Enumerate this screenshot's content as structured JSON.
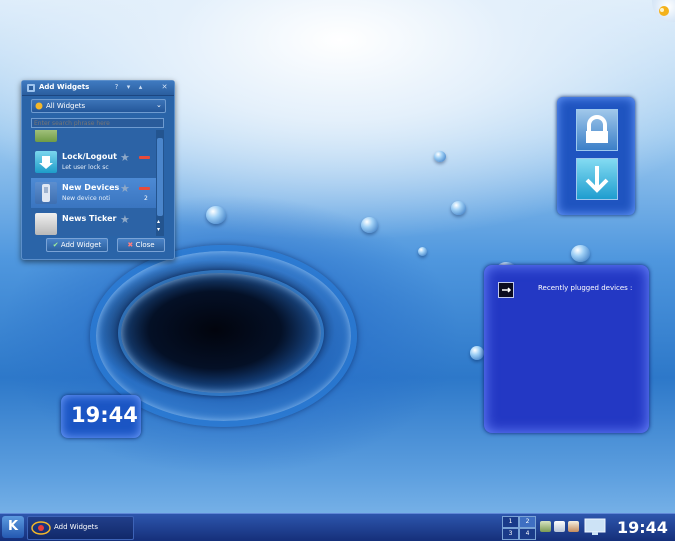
{
  "dialog": {
    "title": "Add Widgets",
    "category": "All Widgets",
    "search_placeholder": "Enter search phrase here",
    "items": [
      {
        "name": "",
        "desc": "",
        "count": ""
      },
      {
        "name": "Lock/Logout",
        "desc": "Let user lock sc",
        "count": ""
      },
      {
        "name": "New Devices",
        "desc": "New device noti",
        "count": "2"
      },
      {
        "name": "News Ticker",
        "desc": "",
        "count": ""
      }
    ],
    "add_label": "Add Widget",
    "close_label": "Close"
  },
  "devices_widget": {
    "title": "Recently plugged devices :"
  },
  "desktop_clock": {
    "time": "19:44"
  },
  "taskbar": {
    "task_label": "Add Widgets",
    "pager": [
      "1",
      "2",
      "3",
      "4"
    ],
    "clock": "19:44"
  },
  "colors": {
    "accent": "#2a64a8",
    "selection": "#4d8ad4",
    "taskbar": "#1e3f90",
    "remove": "#e84b3a"
  }
}
